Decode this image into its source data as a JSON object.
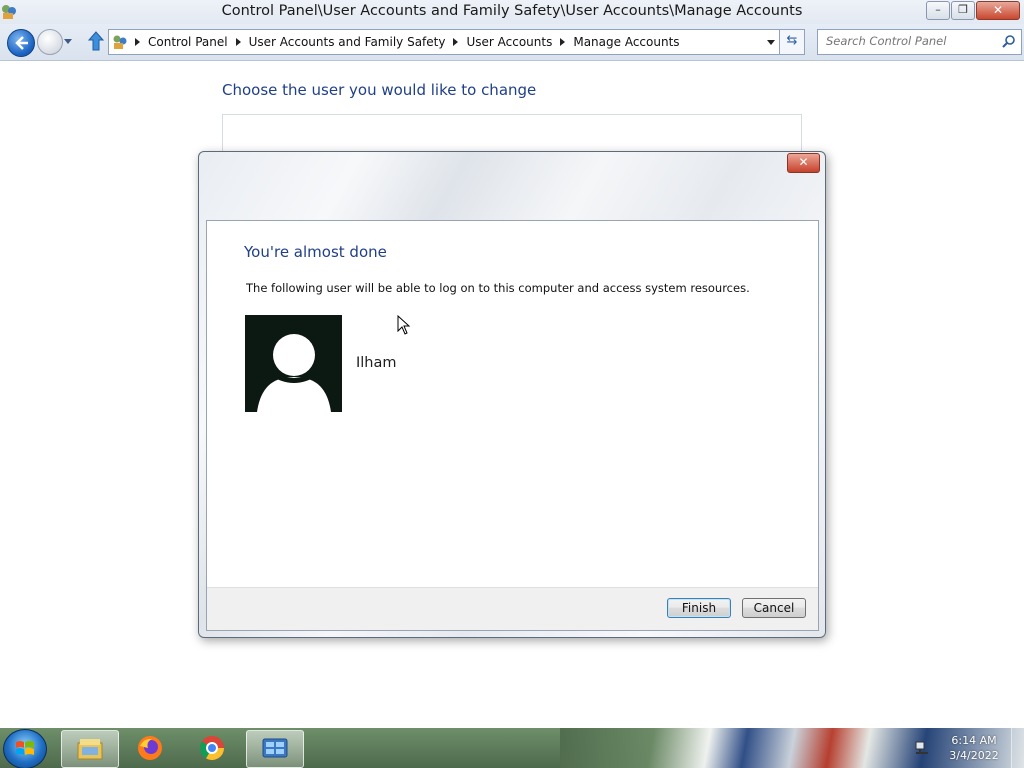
{
  "window": {
    "title": "Control Panel\\User Accounts and Family Safety\\User Accounts\\Manage Accounts",
    "controls": {
      "minimize": "–",
      "restore": "❐",
      "close": "✕"
    }
  },
  "navigation": {
    "breadcrumbs": [
      {
        "label": "Control Panel"
      },
      {
        "label": "User Accounts and Family Safety"
      },
      {
        "label": "User Accounts"
      },
      {
        "label": "Manage Accounts"
      }
    ],
    "search_placeholder": "Search Control Panel"
  },
  "page": {
    "heading": "Choose the user you would like to change"
  },
  "dialog": {
    "title": "You're almost done",
    "description": "The following user will be able to log on to this computer and access system resources.",
    "user_name": "Ilham",
    "close_glyph": "✕",
    "finish_label": "Finish",
    "cancel_label": "Cancel"
  },
  "taskbar": {
    "pinned": [
      {
        "icon": "windows-explorer-icon",
        "active": true
      },
      {
        "icon": "firefox-icon",
        "active": false
      },
      {
        "icon": "chrome-icon",
        "active": false
      },
      {
        "icon": "control-panel-icon",
        "active": true
      }
    ],
    "clock": {
      "time": "6:14 AM",
      "date": "3/4/2022"
    }
  },
  "colors": {
    "heading_blue": "#1f3f87",
    "close_red": "#c6422c",
    "avatar_bg": "#0c1812"
  }
}
